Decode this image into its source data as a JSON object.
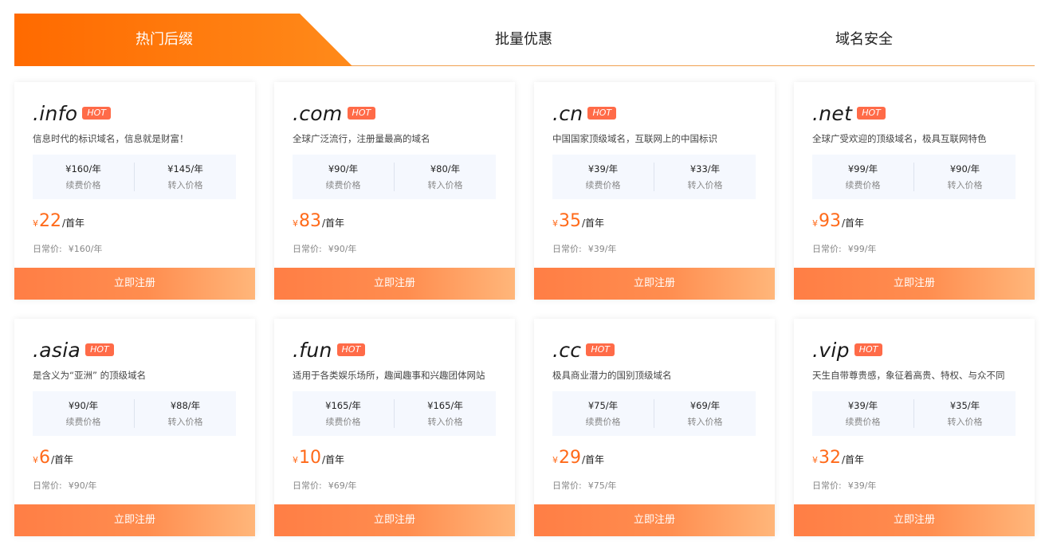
{
  "tabs": [
    {
      "label": "热门后缀"
    },
    {
      "label": "批量优惠"
    },
    {
      "label": "域名安全"
    }
  ],
  "hot_label": "HOT",
  "labels": {
    "renew": "续费价格",
    "transfer": "转入价格",
    "first_year_unit": "/首年",
    "currency": "¥",
    "regular_prefix": "日常价:",
    "register_button": "立即注册"
  },
  "cards": [
    {
      "suffix": ".info",
      "desc": "信息时代的标识域名，信息就是财富！",
      "renew": "¥160/年",
      "transfer": "¥145/年",
      "first": "22",
      "regular": "¥160/年"
    },
    {
      "suffix": ".com",
      "desc": "全球广泛流行，注册量最高的域名",
      "renew": "¥90/年",
      "transfer": "¥80/年",
      "first": "83",
      "regular": "¥90/年"
    },
    {
      "suffix": ".cn",
      "desc": "中国国家顶级域名，互联网上的中国标识",
      "renew": "¥39/年",
      "transfer": "¥33/年",
      "first": "35",
      "regular": "¥39/年"
    },
    {
      "suffix": ".net",
      "desc": "全球广受欢迎的顶级域名，极具互联网特色",
      "renew": "¥99/年",
      "transfer": "¥90/年",
      "first": "93",
      "regular": "¥99/年"
    },
    {
      "suffix": ".asia",
      "desc": "是含义为“亚洲” 的顶级域名",
      "renew": "¥90/年",
      "transfer": "¥88/年",
      "first": "6",
      "regular": "¥90/年"
    },
    {
      "suffix": ".fun",
      "desc": "适用于各类娱乐场所，趣闻趣事和兴趣团体网站",
      "renew": "¥165/年",
      "transfer": "¥165/年",
      "first": "10",
      "regular": "¥69/年"
    },
    {
      "suffix": ".cc",
      "desc": "极具商业潜力的国别顶级域名",
      "renew": "¥75/年",
      "transfer": "¥69/年",
      "first": "29",
      "regular": "¥75/年"
    },
    {
      "suffix": ".vip",
      "desc": "天生自带尊贵感，象征着高贵、特权、与众不同",
      "renew": "¥39/年",
      "transfer": "¥35/年",
      "first": "32",
      "regular": "¥39/年"
    }
  ],
  "colors": {
    "accent": "#ff6a00",
    "hot_badge": "#ff6b48",
    "price_box_bg": "#f5f8fe"
  }
}
